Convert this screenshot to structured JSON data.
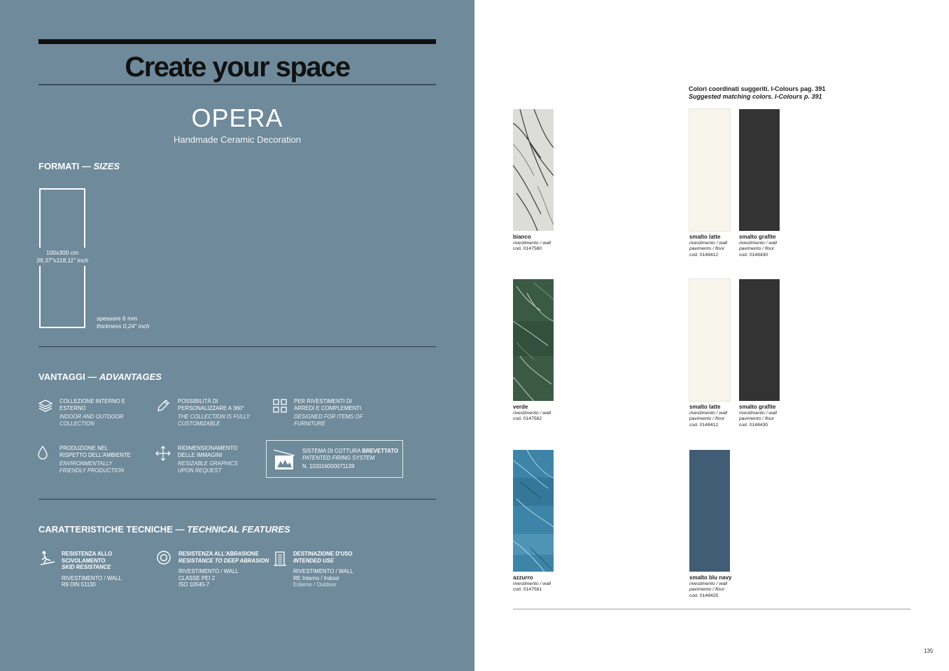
{
  "header": {
    "title": "Create your space",
    "product": "OPERA",
    "subtitle": "Handmade Ceramic Decoration"
  },
  "sizes": {
    "heading": "FORMATI — ",
    "heading_it": "SIZES",
    "dimension_cm": "100x300 cm",
    "dimension_inch": "39,37\"x118,11\" inch",
    "thickness_mm": "spessore 6 mm",
    "thickness_inch": "thickness 0,24\" inch"
  },
  "advantages": {
    "heading": "VANTAGGI — ",
    "heading_it": "ADVANTAGES",
    "items": [
      {
        "icon": "layers-icon",
        "it": "COLLEZIONE INTERNO E ESTERNO",
        "en": "INDOOR AND OUTDOOR COLLECTION"
      },
      {
        "icon": "pencil-icon",
        "it": "POSSIBILITÀ DI PERSONALIZZARE A 360°",
        "en": "THE COLLECTION IS FULLY CUSTOMIZABLE"
      },
      {
        "icon": "grid-icon",
        "it": "PER RIVESTIMENTI DI ARREDI E COMPLEMENTI",
        "en": "DESIGNED FOR ITEMS OF FURNITURE"
      },
      {
        "icon": "drop-icon",
        "it": "PRODUZIONE NEL RISPETTO DELL'AMBIENTE",
        "en": "ENVIRONMENTALLY FRIENDLY PRODUCTION"
      },
      {
        "icon": "move-arrows-icon",
        "it": "RIDIMENSIONAMENTO DELLE IMMAGINI",
        "en": "RESIZABLE GRAPHICS UPON REQUEST"
      }
    ],
    "patent": {
      "line1": "SISTEMA DI COTTURA ",
      "line1_bold": "BREVETTATO",
      "line2": "PATENTED FIRING SYSTEM",
      "line3": "N. 102016000071139"
    }
  },
  "technical": {
    "heading": "CARATTERISTICHE TECNICHE — ",
    "heading_it": "TECHNICAL FEATURES",
    "items": [
      {
        "icon": "skid-icon",
        "t1": "RESISTENZA ALLO",
        "t2": "SCIVOLAMENTO",
        "t3": "SKID RESISTANCE",
        "v1": "RIVESTIMENTO / WALL",
        "v2": "R9 DIN 51130",
        "v3": ""
      },
      {
        "icon": "abrasion-icon",
        "t1": "RESISTENZA ALL'ABRASIONE",
        "t2": "",
        "t3": "RESISTANCE TO DEEP ABRASION",
        "v1": "RIVESTIMENTO / WALL",
        "v2": "CLASSE PEI 2",
        "v3": "ISO 10545-7"
      },
      {
        "icon": "building-icon",
        "t1": "DESTINAZIONE D'USO",
        "t2": "",
        "t3": "INTENDED USE",
        "v1": "RIVESTIMENTO / WALL",
        "v2": "RE Interno / Indoor",
        "v3": "Esterno / Outdoor"
      }
    ]
  },
  "right_page": {
    "heading1": "Colori coordinati suggeriti. I-Colours pag. 391",
    "heading2": "Suggested matching colors. I-Colours p. 391",
    "swatches": [
      {
        "name": "bianco",
        "l1": "rivestimento / wall",
        "l2": "cod. 0147580",
        "l3": "",
        "color": "#d9d9d6"
      },
      {
        "name": "smalto latte",
        "l1": "rivestimento / wall",
        "l2": "pavimento / floor",
        "l3": "cod. 0148412",
        "color": "#f8f5ec"
      },
      {
        "name": "smalto grafite",
        "l1": "rivestimento / wall",
        "l2": "pavimento / floor",
        "l3": "cod. 0148430",
        "color": "#333333"
      },
      {
        "name": "verde",
        "l1": "rivestimento / wall",
        "l2": "cod. 0147582",
        "l3": "",
        "color": "#3b5a44"
      },
      {
        "name": "smalto latte",
        "l1": "rivestimento / wall",
        "l2": "pavimento / floor",
        "l3": "cod. 0148412",
        "color": "#f8f5ec"
      },
      {
        "name": "smalto grafite",
        "l1": "rivestimento / wall",
        "l2": "pavimento / floor",
        "l3": "cod. 0148430",
        "color": "#333333"
      },
      {
        "name": "azzurro",
        "l1": "rivestimento / wall",
        "l2": "cod. 0147581",
        "l3": "",
        "color": "#3e84a8"
      },
      {
        "name": "smalto blu navy",
        "l1": "rivestimento / wall",
        "l2": "pavimento / floor",
        "l3": "cod. 0148425",
        "color": "#415d75"
      }
    ],
    "page_number": "135"
  }
}
